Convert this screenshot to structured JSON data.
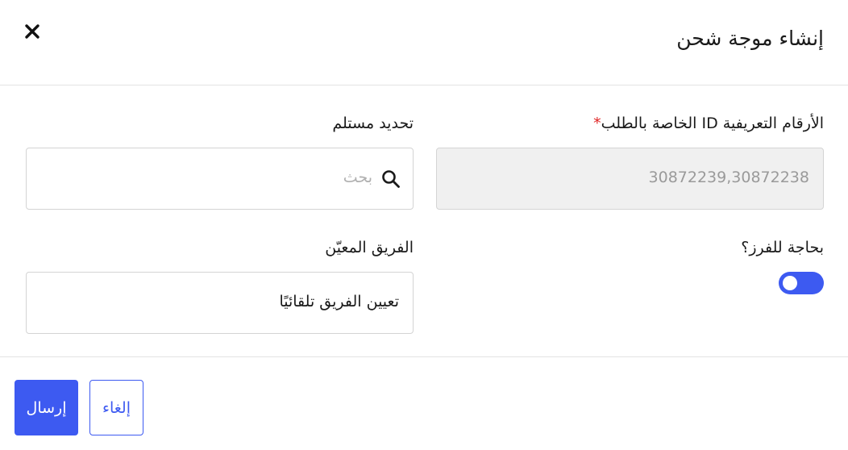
{
  "dialog": {
    "title": "إنشاء موجة شحن",
    "close_icon": "close-icon"
  },
  "form": {
    "order_ids": {
      "label": "الأرقام التعريفية ID الخاصة بالطلب",
      "required_mark": "*",
      "value": "30872239,30872238",
      "disabled": true
    },
    "recipient": {
      "label": "تحديد مستلم",
      "placeholder": "بحث",
      "icon": "search-icon"
    },
    "needs_sorting": {
      "label": "بحاجة للفرز؟",
      "enabled": false
    },
    "assigned_team": {
      "label": "الفريق المعيّن",
      "value": "تعيين الفريق تلقائيًا"
    }
  },
  "footer": {
    "submit_label": "إرسال",
    "cancel_label": "إلغاء"
  },
  "colors": {
    "accent": "#3d5af1",
    "required": "#e02424",
    "disabled_bg": "#f0f0f0",
    "border": "#d4d4d4"
  }
}
